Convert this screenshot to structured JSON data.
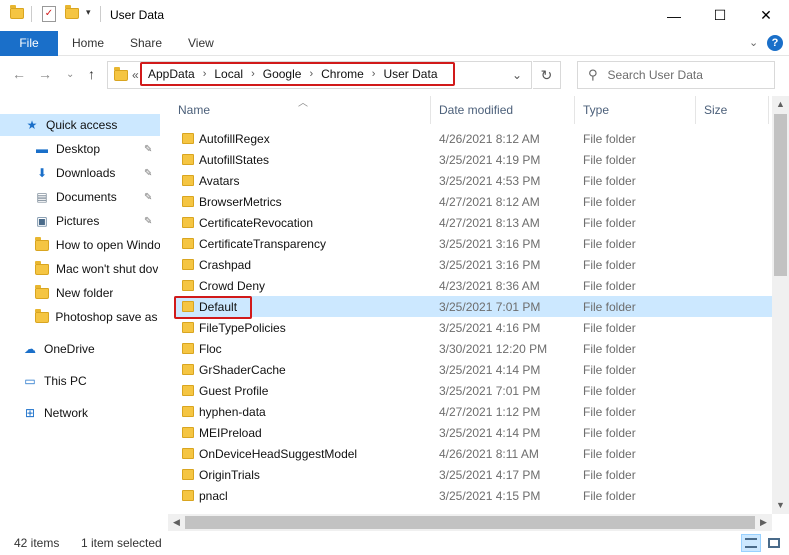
{
  "window": {
    "title": "User Data",
    "minimize": "—",
    "maximize": "☐",
    "close": "✕"
  },
  "ribbon": {
    "tabs": [
      "File",
      "Home",
      "Share",
      "View"
    ],
    "help": "?",
    "collapse": "⌄"
  },
  "nav": {
    "back": "←",
    "forward": "→",
    "recent": "⌄",
    "up": "↑",
    "overflow": "«",
    "breadcrumb": [
      "AppData",
      "Local",
      "Google",
      "Chrome",
      "User Data"
    ],
    "separator": "›",
    "history": "⌄",
    "refresh": "↻",
    "search_placeholder": "Search User Data",
    "search_icon": "⚲"
  },
  "sidebar": {
    "items": [
      {
        "label": "Quick access",
        "icon": "star-icon",
        "glyph": "★",
        "color": "#1a6fc9",
        "pinned": false
      },
      {
        "label": "Desktop",
        "icon": "desktop-icon",
        "glyph": "▬",
        "color": "#1a6fc9",
        "pinned": true
      },
      {
        "label": "Downloads",
        "icon": "download-icon",
        "glyph": "⬇",
        "color": "#1a6fc9",
        "pinned": true
      },
      {
        "label": "Documents",
        "icon": "document-icon",
        "glyph": "▤",
        "color": "#6d7d8c",
        "pinned": true
      },
      {
        "label": "Pictures",
        "icon": "pictures-icon",
        "glyph": "▣",
        "color": "#4a6b8a",
        "pinned": true
      },
      {
        "label": "How to open Windo",
        "icon": "folder-icon",
        "glyph": "",
        "color": "#f5c542",
        "pinned": false
      },
      {
        "label": "Mac won't shut dov",
        "icon": "folder-icon",
        "glyph": "",
        "color": "#f5c542",
        "pinned": false
      },
      {
        "label": "New folder",
        "icon": "folder-icon",
        "glyph": "",
        "color": "#f5c542",
        "pinned": false
      },
      {
        "label": "Photoshop save as I",
        "icon": "folder-icon",
        "glyph": "",
        "color": "#f5c542",
        "pinned": false
      },
      {
        "label": "OneDrive",
        "icon": "cloud-icon",
        "glyph": "☁",
        "color": "#1a6fc9",
        "pinned": false
      },
      {
        "label": "This PC",
        "icon": "computer-icon",
        "glyph": "▭",
        "color": "#1a6fc9",
        "pinned": false
      },
      {
        "label": "Network",
        "icon": "network-icon",
        "glyph": "⊞",
        "color": "#1a6fc9",
        "pinned": false
      }
    ],
    "pin_glyph": "📌"
  },
  "columns": {
    "name": "Name",
    "date": "Date modified",
    "type": "Type",
    "size": "Size"
  },
  "files": [
    {
      "name": "AutofillRegex",
      "date": "4/26/2021 8:12 AM",
      "type": "File folder"
    },
    {
      "name": "AutofillStates",
      "date": "3/25/2021 4:19 PM",
      "type": "File folder"
    },
    {
      "name": "Avatars",
      "date": "3/25/2021 4:53 PM",
      "type": "File folder"
    },
    {
      "name": "BrowserMetrics",
      "date": "4/27/2021 8:12 AM",
      "type": "File folder"
    },
    {
      "name": "CertificateRevocation",
      "date": "4/27/2021 8:13 AM",
      "type": "File folder"
    },
    {
      "name": "CertificateTransparency",
      "date": "3/25/2021 3:16 PM",
      "type": "File folder"
    },
    {
      "name": "Crashpad",
      "date": "3/25/2021 3:16 PM",
      "type": "File folder"
    },
    {
      "name": "Crowd Deny",
      "date": "4/23/2021 8:36 AM",
      "type": "File folder"
    },
    {
      "name": "Default",
      "date": "3/25/2021 7:01 PM",
      "type": "File folder"
    },
    {
      "name": "FileTypePolicies",
      "date": "3/25/2021 4:16 PM",
      "type": "File folder"
    },
    {
      "name": "Floc",
      "date": "3/30/2021 12:20 PM",
      "type": "File folder"
    },
    {
      "name": "GrShaderCache",
      "date": "3/25/2021 4:14 PM",
      "type": "File folder"
    },
    {
      "name": "Guest Profile",
      "date": "3/25/2021 7:01 PM",
      "type": "File folder"
    },
    {
      "name": "hyphen-data",
      "date": "4/27/2021 1:12 PM",
      "type": "File folder"
    },
    {
      "name": "MEIPreload",
      "date": "3/25/2021 4:14 PM",
      "type": "File folder"
    },
    {
      "name": "OnDeviceHeadSuggestModel",
      "date": "4/26/2021 8:11 AM",
      "type": "File folder"
    },
    {
      "name": "OriginTrials",
      "date": "3/25/2021 4:17 PM",
      "type": "File folder"
    },
    {
      "name": "pnacl",
      "date": "3/25/2021 4:15 PM",
      "type": "File folder"
    }
  ],
  "selected_file": "Default",
  "status": {
    "count": "42 items",
    "selection": "1 item selected"
  },
  "colors": {
    "accent": "#1a6fc9",
    "selection": "#cce8ff",
    "highlight_border": "#d11a1a",
    "folder": "#f5c542"
  }
}
